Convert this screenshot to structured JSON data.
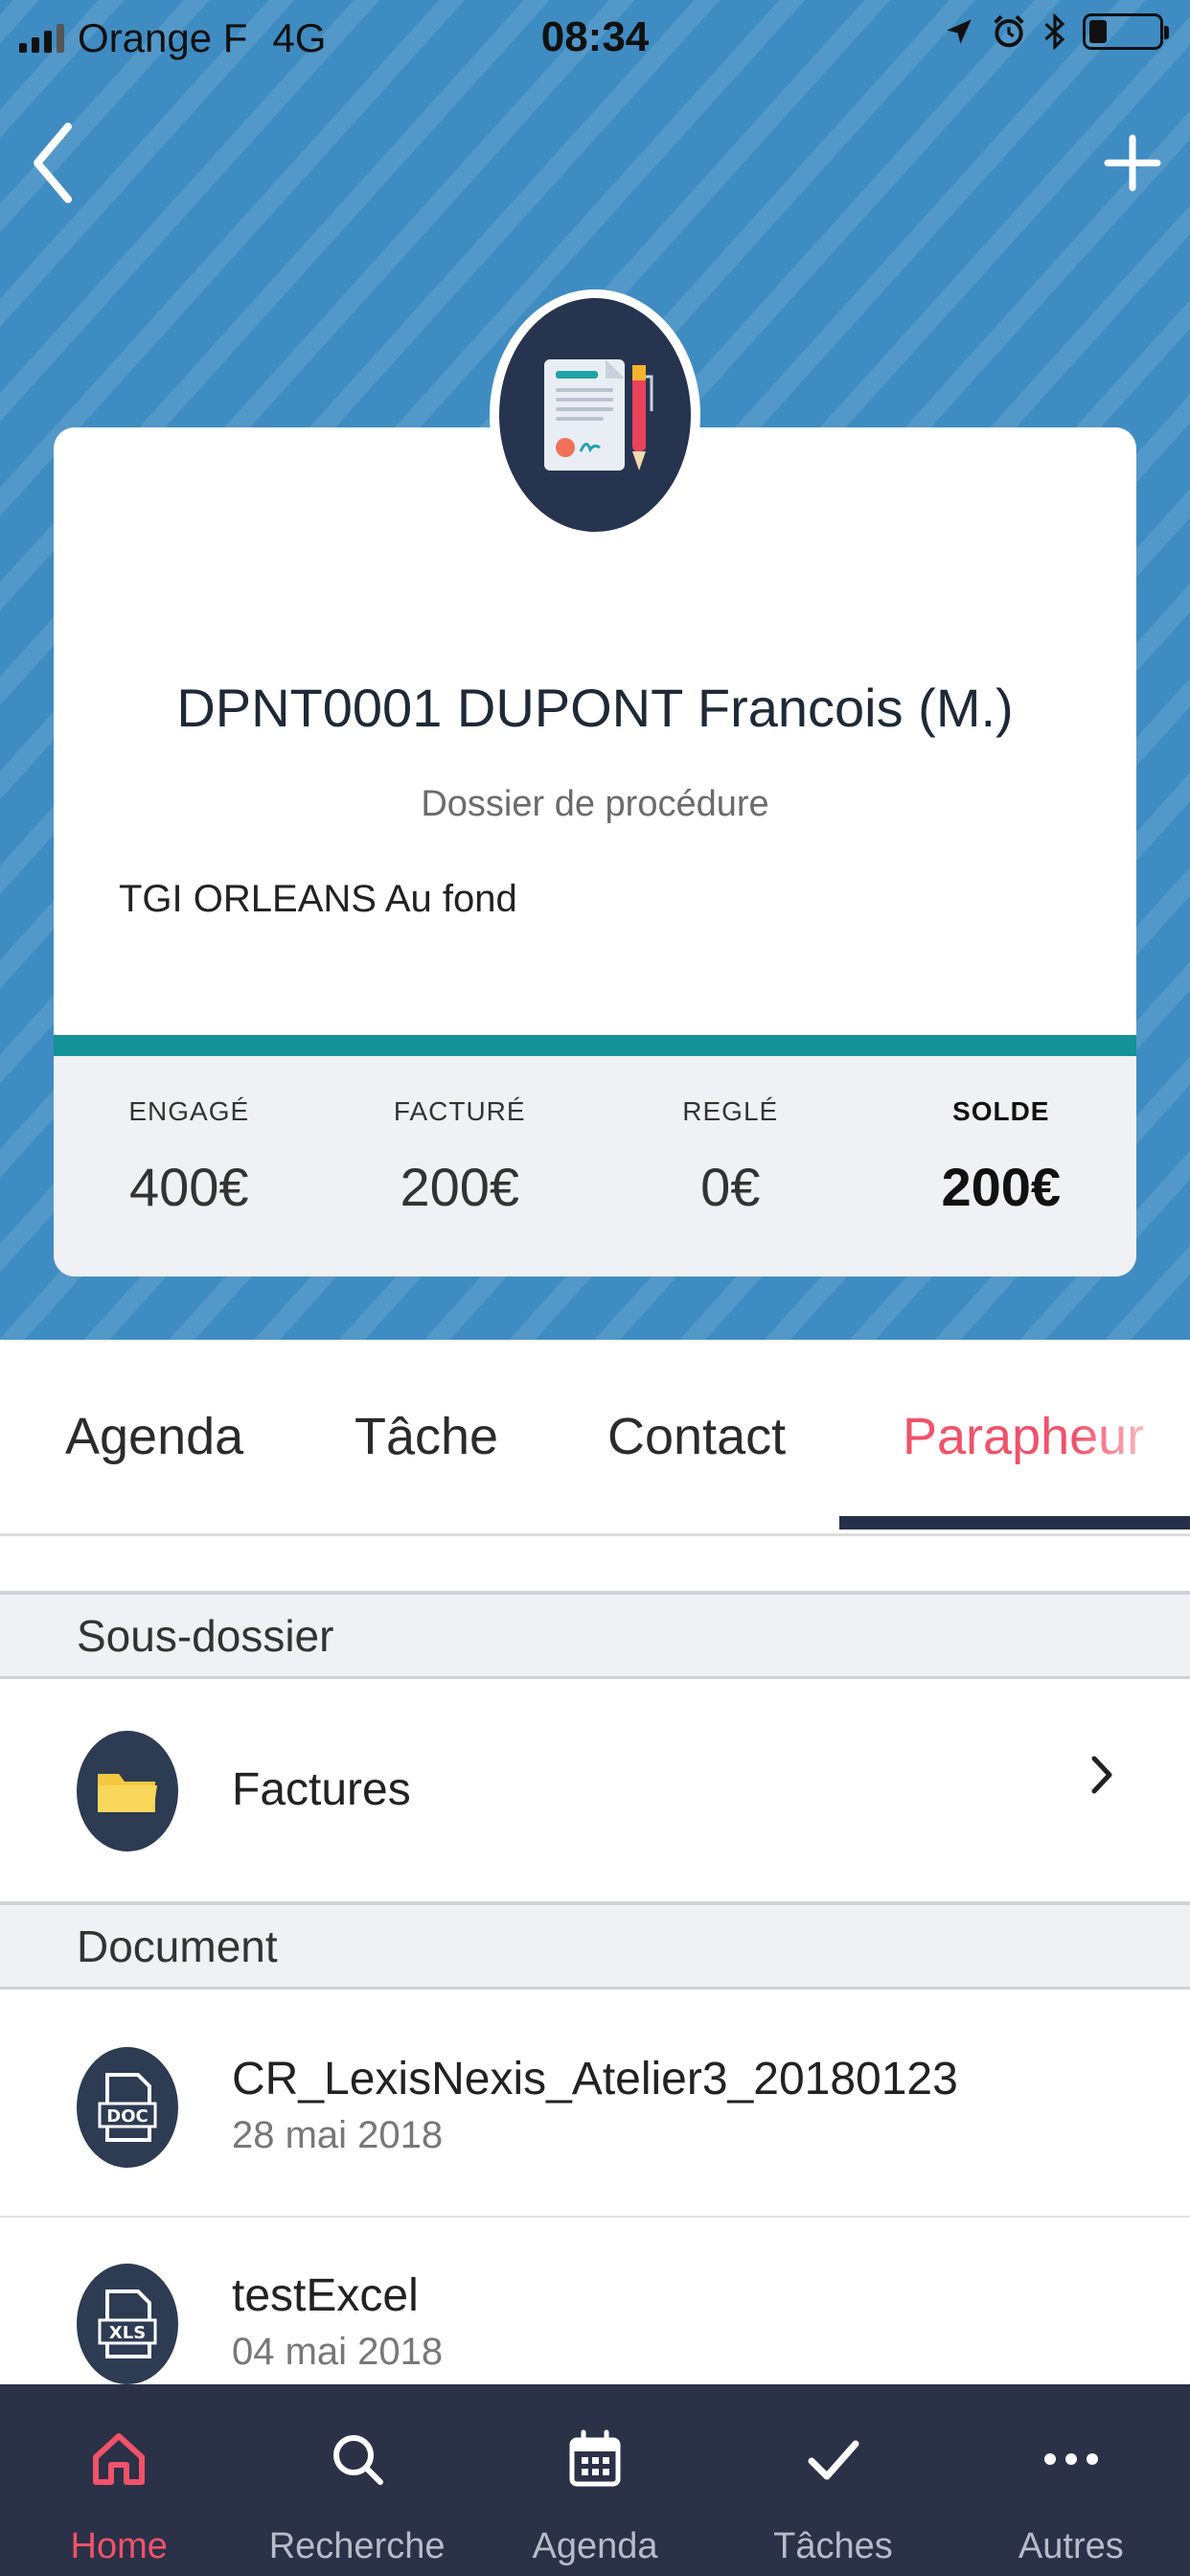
{
  "status_bar": {
    "carrier": "Orange F",
    "network": "4G",
    "time": "08:34"
  },
  "header": {
    "back_icon": "chevron-left-icon",
    "add_icon": "plus-icon",
    "avatar_icon": "document-signature-icon"
  },
  "dossier": {
    "title": "DPNT0001 DUPONT Francois (M.)",
    "type": "Dossier de procédure",
    "description": "TGI ORLEANS Au fond",
    "accent_color": "#139297",
    "stats": [
      {
        "label": "ENGAGÉ",
        "value": "400€"
      },
      {
        "label": "FACTURÉ",
        "value": "200€"
      },
      {
        "label": "REGLÉ",
        "value": "0€"
      },
      {
        "label": "SOLDE",
        "value": "200€"
      }
    ]
  },
  "tabs": {
    "items": [
      {
        "label": "Agenda"
      },
      {
        "label": "Tâche"
      },
      {
        "label": "Contact"
      },
      {
        "label": "Parapheur"
      }
    ],
    "active_index": 3,
    "active_color": "#f0526a"
  },
  "sections": {
    "subfolder": {
      "header": "Sous-dossier",
      "items": [
        {
          "title": "Factures",
          "icon": "folder-icon"
        }
      ]
    },
    "documents": {
      "header": "Document",
      "items": [
        {
          "title": "CR_LexisNexis_Atelier3_20180123",
          "date": "28 mai 2018",
          "icon": "doc-file-icon"
        },
        {
          "title": "testExcel",
          "date": "04 mai 2018",
          "icon": "xls-file-icon"
        }
      ]
    }
  },
  "bottom_nav": {
    "items": [
      {
        "label": "Home",
        "icon": "home-icon"
      },
      {
        "label": "Recherche",
        "icon": "search-icon"
      },
      {
        "label": "Agenda",
        "icon": "calendar-icon"
      },
      {
        "label": "Tâches",
        "icon": "checkmark-icon"
      },
      {
        "label": "Autres",
        "icon": "more-icon"
      }
    ],
    "active_index": 0
  }
}
